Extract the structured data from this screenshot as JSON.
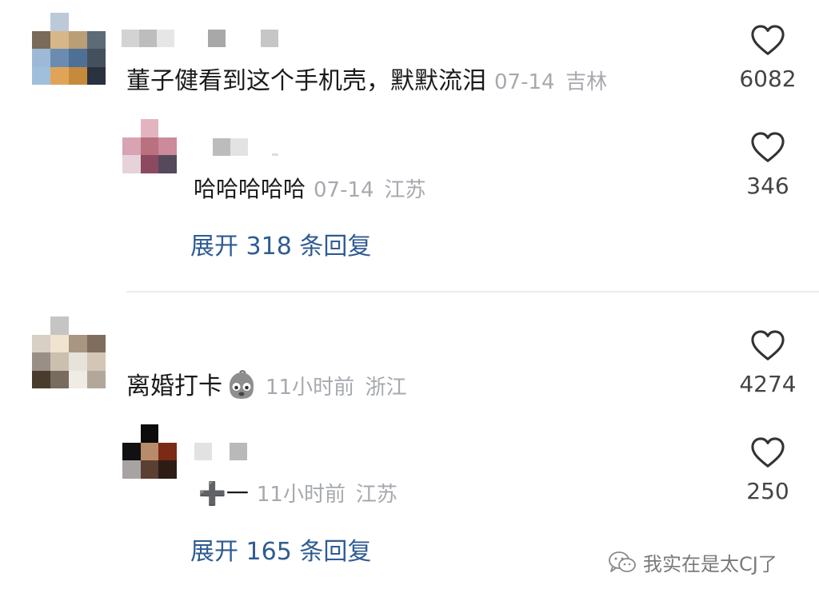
{
  "comments": [
    {
      "text": "董子健看到这个手机壳，默默流泪",
      "date": "07-14",
      "location": "吉林",
      "likes": "6082",
      "reply": {
        "text": "哈哈哈哈哈",
        "date": "07-14",
        "location": "江苏",
        "likes": "346"
      },
      "expand_label": "展开 318 条回复"
    },
    {
      "text": "离婚打卡",
      "emoji": "crying-ghost-emoji",
      "date": "11小时前",
      "location": "浙江",
      "likes": "4274",
      "reply": {
        "text": "➕一",
        "date": "11小时前",
        "location": "江苏",
        "likes": "250"
      },
      "expand_label": "展开 165 条回复"
    }
  ],
  "watermark": {
    "icon": "wechat-icon",
    "text": "我实在是太CJ了"
  },
  "colors": {
    "link": "#2f5b93",
    "meta": "#a6a9ae",
    "heart": "#333333"
  }
}
